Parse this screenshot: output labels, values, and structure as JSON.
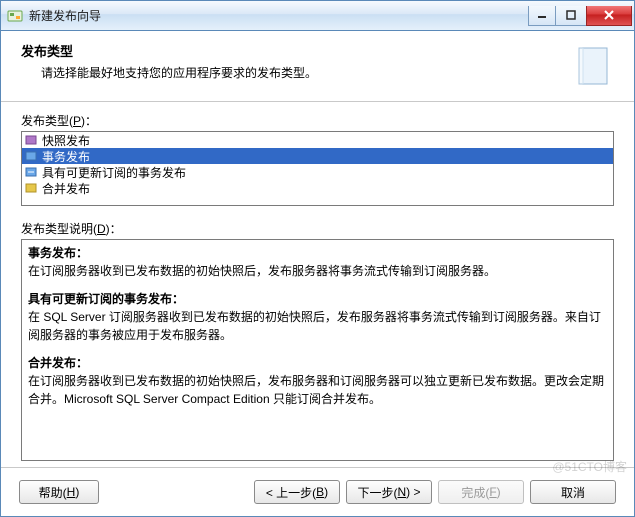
{
  "window": {
    "title": "新建发布向导"
  },
  "header": {
    "title": "发布类型",
    "subtitle": "请选择能最好地支持您的应用程序要求的发布类型。"
  },
  "type_list": {
    "label_pre": "发布类型(",
    "label_accel": "P",
    "label_post": ")：",
    "items": [
      {
        "label": "快照发布",
        "icon": "snapshot-icon",
        "selected": false
      },
      {
        "label": "事务发布",
        "icon": "transaction-icon",
        "selected": true
      },
      {
        "label": "具有可更新订阅的事务发布",
        "icon": "updatable-transaction-icon",
        "selected": false
      },
      {
        "label": "合并发布",
        "icon": "merge-icon",
        "selected": false
      }
    ]
  },
  "description": {
    "label_pre": "发布类型说明(",
    "label_accel": "D",
    "label_post": ")：",
    "sections": [
      {
        "title": "事务发布：",
        "body": "在订阅服务器收到已发布数据的初始快照后，发布服务器将事务流式传输到订阅服务器。"
      },
      {
        "title": "具有可更新订阅的事务发布：",
        "body": "在 SQL Server 订阅服务器收到已发布数据的初始快照后，发布服务器将事务流式传输到订阅服务器。来自订阅服务器的事务被应用于发布服务器。"
      },
      {
        "title": "合并发布：",
        "body": "在订阅服务器收到已发布数据的初始快照后，发布服务器和订阅服务器可以独立更新已发布数据。更改会定期合并。Microsoft SQL Server Compact Edition 只能订阅合并发布。"
      }
    ]
  },
  "buttons": {
    "help": {
      "pre": "帮助(",
      "accel": "H",
      "post": ")"
    },
    "back": {
      "pre": "< 上一步(",
      "accel": "B",
      "post": ")"
    },
    "next": {
      "pre": "下一步(",
      "accel": "N",
      "post": ") >"
    },
    "finish": {
      "pre": "完成(",
      "accel": "F",
      "post": ")",
      "disabled": true
    },
    "cancel": {
      "label": "取消"
    }
  },
  "watermark": "@51CTO博客"
}
